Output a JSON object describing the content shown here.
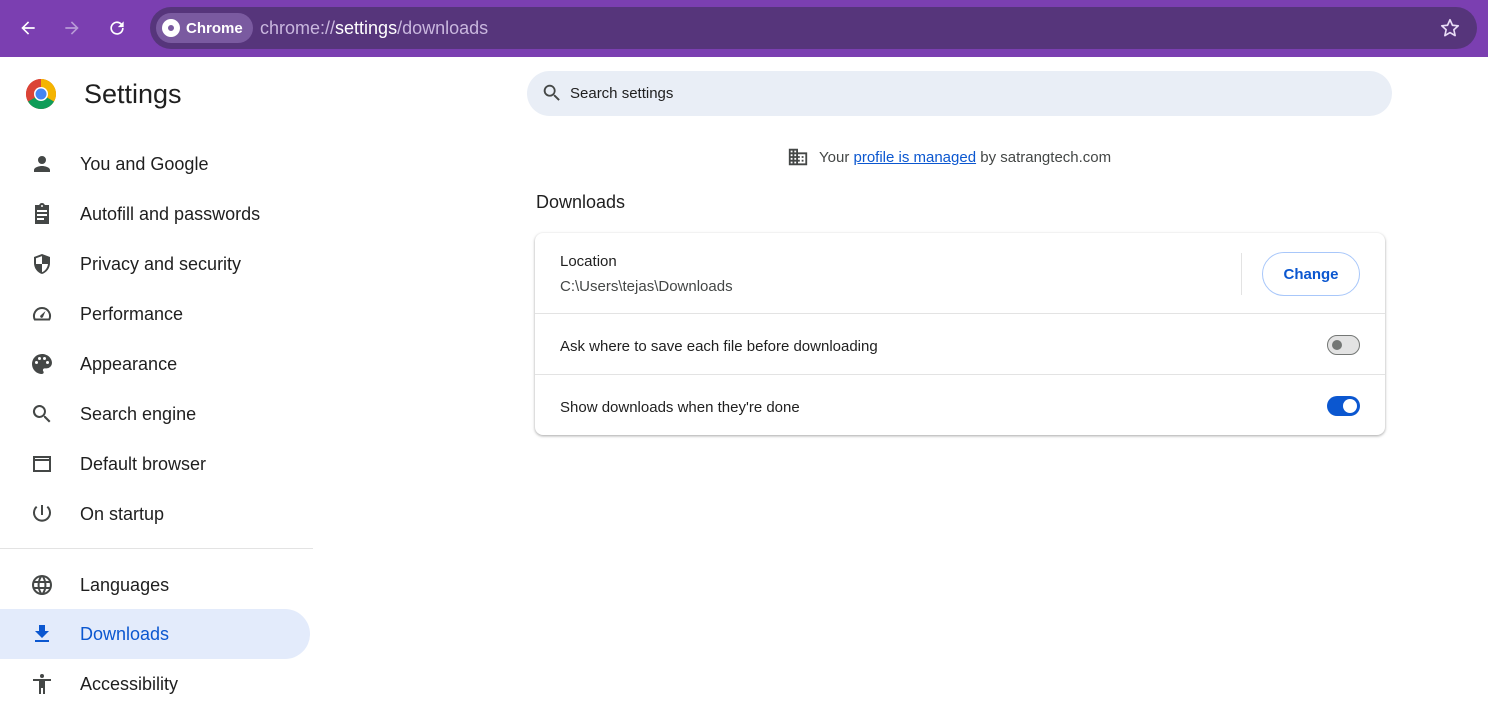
{
  "browser": {
    "chip_label": "Chrome",
    "url_scheme": "chrome://",
    "url_host": "settings",
    "url_path": "/downloads",
    "theme_color": "#7b3fb1"
  },
  "sidebar": {
    "title": "Settings",
    "items": [
      {
        "label": "You and Google",
        "icon": "person-icon"
      },
      {
        "label": "Autofill and passwords",
        "icon": "clipboard-icon"
      },
      {
        "label": "Privacy and security",
        "icon": "shield-icon"
      },
      {
        "label": "Performance",
        "icon": "speedometer-icon"
      },
      {
        "label": "Appearance",
        "icon": "palette-icon"
      },
      {
        "label": "Search engine",
        "icon": "search-icon"
      },
      {
        "label": "Default browser",
        "icon": "browser-window-icon"
      },
      {
        "label": "On startup",
        "icon": "power-icon"
      },
      {
        "label": "Languages",
        "icon": "globe-icon"
      },
      {
        "label": "Downloads",
        "icon": "download-icon",
        "active": true
      },
      {
        "label": "Accessibility",
        "icon": "accessibility-icon"
      }
    ]
  },
  "search": {
    "placeholder": "Search settings"
  },
  "managed": {
    "prefix": "Your",
    "link": "profile is managed",
    "suffix": "by satrangtech.com"
  },
  "downloads": {
    "section_title": "Downloads",
    "location_label": "Location",
    "location_path": "C:\\Users\\tejas\\Downloads",
    "change_label": "Change",
    "ask_label": "Ask where to save each file before downloading",
    "ask_enabled": false,
    "show_label": "Show downloads when they're done",
    "show_enabled": true
  }
}
